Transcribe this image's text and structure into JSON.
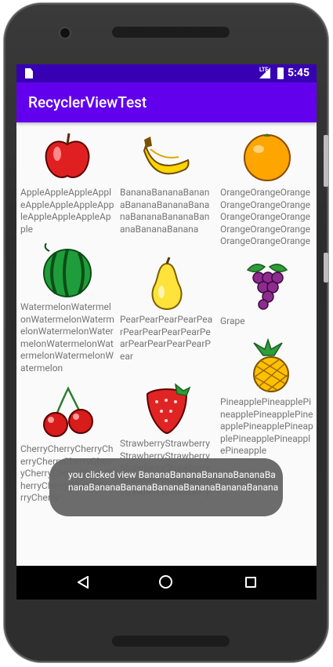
{
  "status_bar": {
    "time": "5:45",
    "network": "LTE"
  },
  "app_bar": {
    "title": "RecyclerViewTest"
  },
  "fruits": [
    {
      "name": "AppleAppleAppleAppleAppleAppleAppleAppleAppleAppleAppleApple",
      "icon": "apple-icon"
    },
    {
      "name": "BananaBananaBananaBananaBananaBananaBananaBananaBananaBananaBanana",
      "icon": "banana-icon"
    },
    {
      "name": "OrangeOrangeOrangeOrangeOrangeOrangeOrangeOrangeOrangeOrangeOrangeOrangeOrangeOrangeOrange",
      "icon": "orange-icon"
    },
    {
      "name": "WatermelonWatermelonWatermelonWatermelonWatermelonWatermelonWatermelonWatermelonWatermelonWatermelon",
      "icon": "watermelon-icon"
    },
    {
      "name": "PearPearPearPearPearPearPearPearPearPearPearPearPearPearPear",
      "icon": "pear-icon"
    },
    {
      "name": "Grape",
      "icon": "grape-icon"
    },
    {
      "name": "CherryCherryCherryCherryCherryCherryCherryCherryCherryCherryCherryCherryCherryCherryCherry",
      "icon": "cherry-icon"
    },
    {
      "name": "StrawberryStrawberryStrawberryStrawberryStrawberryStrawberryStrawberryStrawberryStrawberryStrawberry",
      "icon": "strawberry-icon"
    },
    {
      "name": "PineapplePineapplePineapplePineapplePineapplePineapplePineapplePineapplePineapplePineapple",
      "icon": "pineapple-icon"
    }
  ],
  "toast": {
    "message": "you clicked view BananaBananaBananaBananaBananaBananaBananaBananaBananaBananaBanana"
  },
  "nav_bar": {
    "back": "back-icon",
    "home": "home-icon",
    "recents": "recents-icon"
  }
}
